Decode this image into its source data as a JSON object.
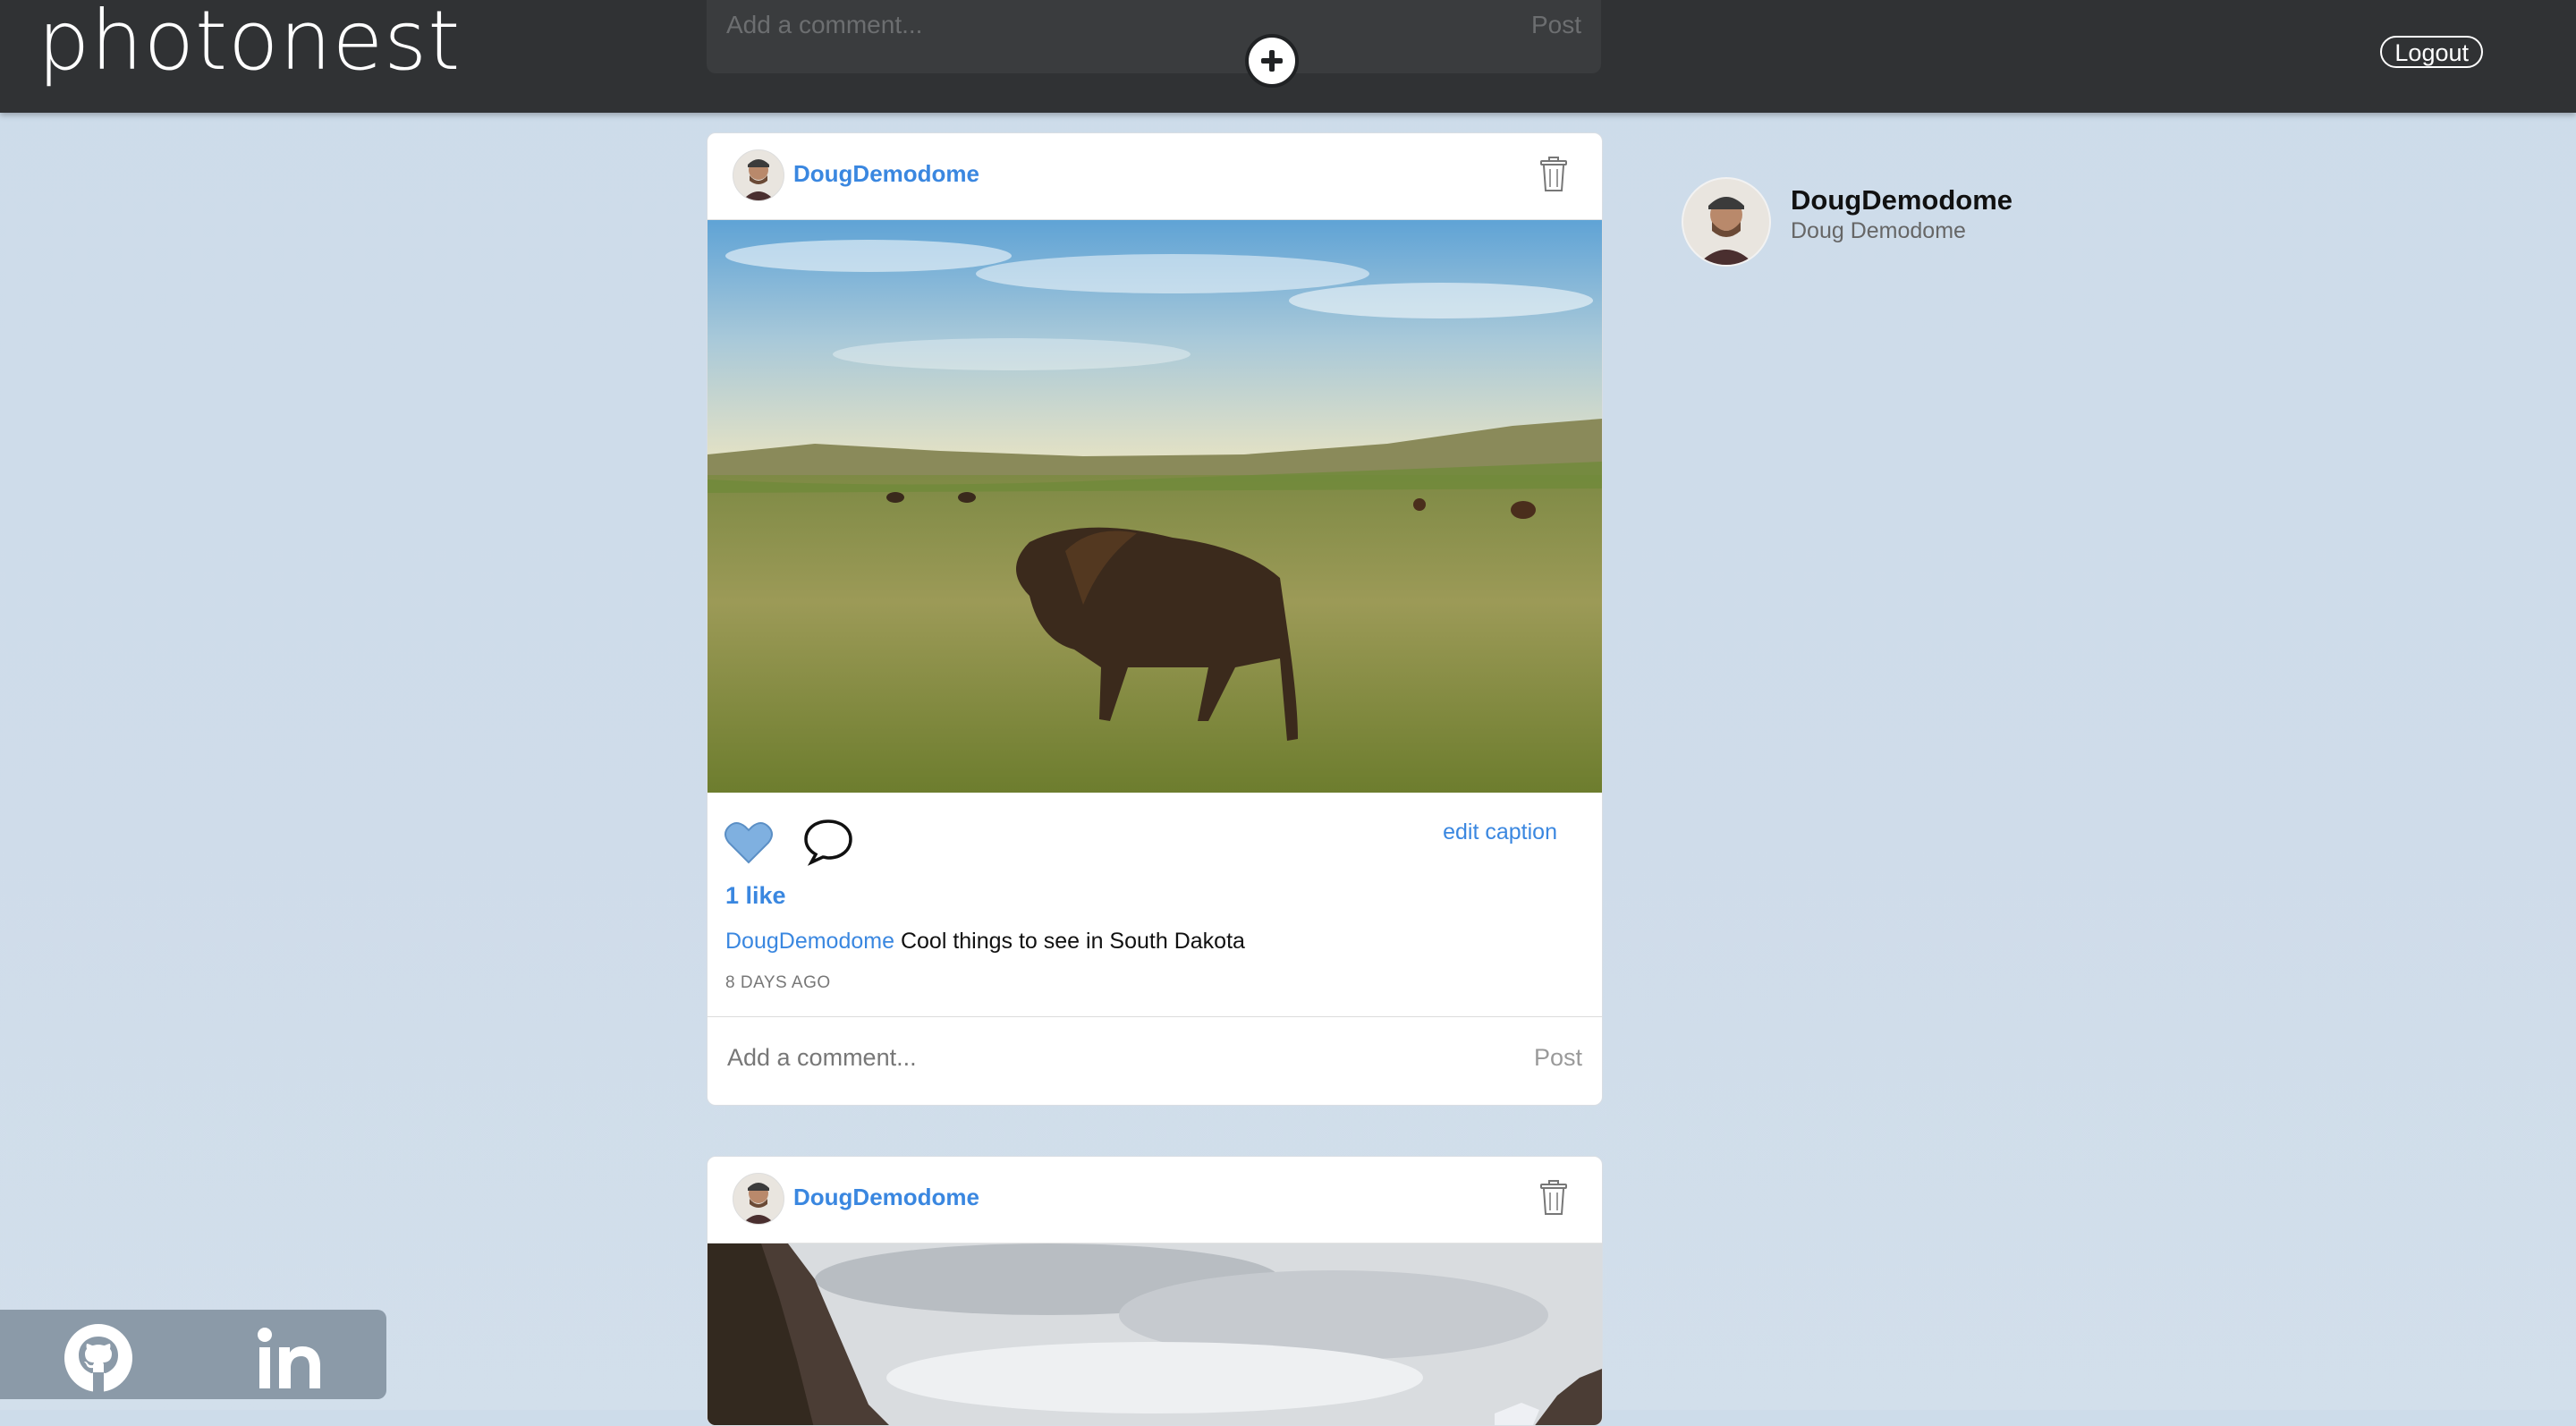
{
  "header": {
    "logo": "photonest",
    "logout_label": "Logout",
    "add_icon": "plus-circle-icon"
  },
  "top_comment": {
    "placeholder": "Add a comment...",
    "post_label": "Post"
  },
  "posts": [
    {
      "username": "DougDemodome",
      "caption_user": "DougDemodome",
      "caption": "Cool things to see in South Dakota",
      "likes": "1 like",
      "edit_caption": "edit caption",
      "age": "8 DAYS AGO",
      "comment_placeholder": "Add a comment...",
      "post_label": "Post",
      "liked": true
    },
    {
      "username": "DougDemodome"
    }
  ],
  "profile": {
    "username": "DougDemodome",
    "full_name": "Doug Demodome"
  },
  "social": {
    "github_icon": "github-icon",
    "linkedin_icon": "linkedin-icon"
  },
  "colors": {
    "header_bg": "#303234",
    "accent": "#3a87e0",
    "page_bg": "#cddcea",
    "heart": "#7fb0e0"
  }
}
